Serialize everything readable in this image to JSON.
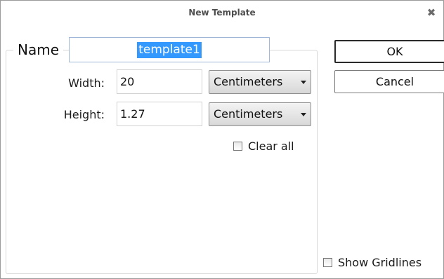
{
  "dialog": {
    "title": "New Template"
  },
  "form": {
    "name_label": "Name",
    "name_value": "template1",
    "width_label": "Width:",
    "width_value": "20",
    "width_unit": "Centimeters",
    "height_label": "Height:",
    "height_value": "1.27",
    "height_unit": "Centimeters",
    "clear_all_label": "Clear all",
    "clear_all_checked": false
  },
  "buttons": {
    "ok_label": "OK",
    "cancel_label": "Cancel"
  },
  "options": {
    "show_gridlines_label": "Show Gridlines",
    "show_gridlines_checked": false
  },
  "icons": {
    "close": "close-icon"
  }
}
